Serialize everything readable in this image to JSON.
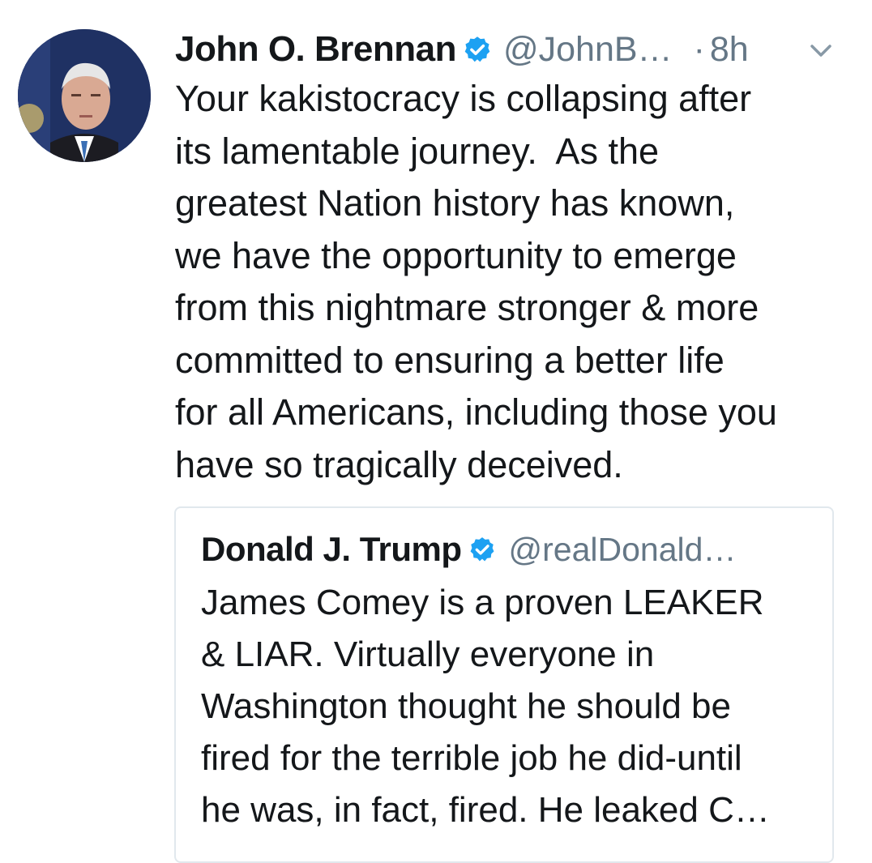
{
  "tweet": {
    "author_name": "John O. Brennan",
    "author_handle": "@JohnB…",
    "separator": "·",
    "time": "8h",
    "text": "Your kakistocracy is collapsing after\nits lamentable journey.  As the\ngreatest Nation history has known,\nwe have the opportunity to emerge\nfrom this nightmare stronger & more\ncommitted to ensuring a better life\nfor all Americans, including those you\nhave so tragically deceived.",
    "icons": {
      "verified": "verified-badge-icon",
      "menu": "chevron-down-icon"
    }
  },
  "quoted_tweet": {
    "author_name": "Donald J. Trump",
    "author_handle": "@realDonald…",
    "text": "James Comey is a proven LEAKER\n& LIAR. Virtually everyone in\nWashington thought he should be\nfired for the terrible job he did-until\nhe was, in fact, fired. He leaked C…"
  },
  "colors": {
    "text_primary": "#14171a",
    "text_secondary": "#657786",
    "verified_blue": "#1da1f2",
    "border": "#e1e8ed"
  }
}
